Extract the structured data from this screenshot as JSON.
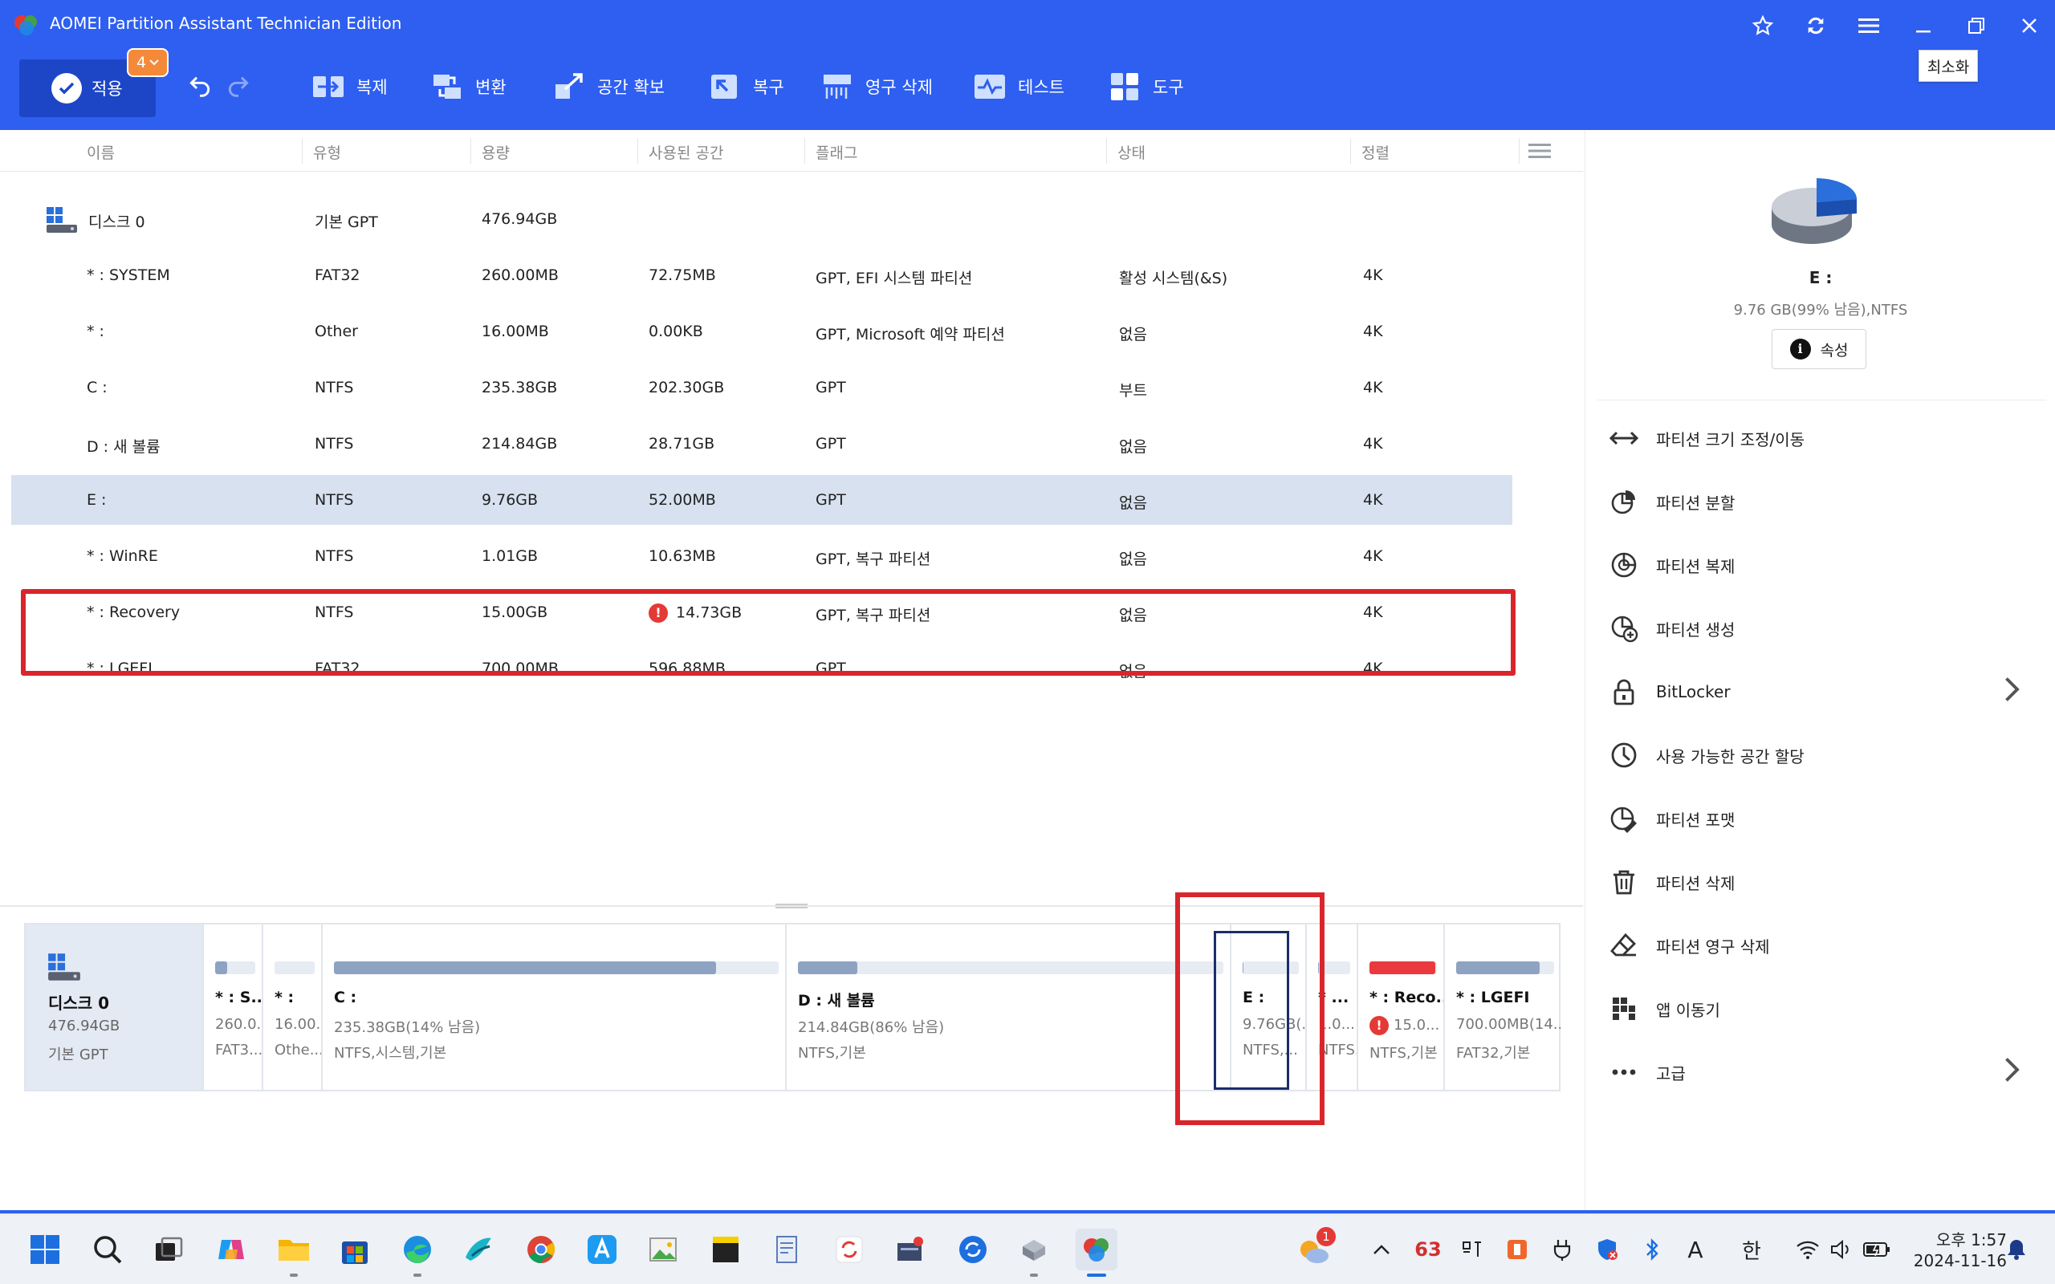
{
  "window": {
    "title": "AOMEI Partition Assistant Technician Edition",
    "tooltip": "최소화"
  },
  "toolbar": {
    "apply_label": "적용",
    "apply_badge": "4",
    "items": [
      {
        "label": "복제",
        "icon": "clone-icon"
      },
      {
        "label": "변환",
        "icon": "convert-icon"
      },
      {
        "label": "공간 확보",
        "icon": "free-up-space-icon"
      },
      {
        "label": "복구",
        "icon": "recover-icon"
      },
      {
        "label": "영구 삭제",
        "icon": "wipe-icon"
      },
      {
        "label": "테스트",
        "icon": "test-icon"
      },
      {
        "label": "도구",
        "icon": "tools-icon"
      }
    ]
  },
  "table": {
    "columns": [
      "이름",
      "유형",
      "용량",
      "사용된 공간",
      "플래그",
      "상태",
      "정렬"
    ],
    "disk_row": {
      "name": "디스크 0",
      "type": "기본 GPT",
      "capacity": "476.94GB"
    },
    "partitions": [
      {
        "name": "* : SYSTEM",
        "type": "FAT32",
        "capacity": "260.00MB",
        "used": "72.75MB",
        "flag": "GPT, EFI 시스템 파티션",
        "status": "활성 시스템(&S)",
        "align": "4K",
        "warn": false
      },
      {
        "name": "* :",
        "type": "Other",
        "capacity": "16.00MB",
        "used": "0.00KB",
        "flag": "GPT, Microsoft 예약 파티션",
        "status": "없음",
        "align": "4K",
        "warn": false
      },
      {
        "name": "C :",
        "type": "NTFS",
        "capacity": "235.38GB",
        "used": "202.30GB",
        "flag": "GPT",
        "status": "부트",
        "align": "4K",
        "warn": false
      },
      {
        "name": "D : 새 볼륨",
        "type": "NTFS",
        "capacity": "214.84GB",
        "used": "28.71GB",
        "flag": "GPT",
        "status": "없음",
        "align": "4K",
        "warn": false
      },
      {
        "name": "E :",
        "type": "NTFS",
        "capacity": "9.76GB",
        "used": "52.00MB",
        "flag": "GPT",
        "status": "없음",
        "align": "4K",
        "warn": false,
        "selected": true
      },
      {
        "name": "* : WinRE",
        "type": "NTFS",
        "capacity": "1.01GB",
        "used": "10.63MB",
        "flag": "GPT, 복구 파티션",
        "status": "없음",
        "align": "4K",
        "warn": false
      },
      {
        "name": "* : Recovery",
        "type": "NTFS",
        "capacity": "15.00GB",
        "used": "14.73GB",
        "flag": "GPT, 복구 파티션",
        "status": "없음",
        "align": "4K",
        "warn": true
      },
      {
        "name": "* : LGEFI",
        "type": "FAT32",
        "capacity": "700.00MB",
        "used": "596.88MB",
        "flag": "GPT",
        "status": "없음",
        "align": "4K",
        "warn": false
      }
    ],
    "warn_glyph": "!"
  },
  "diskmap": {
    "disk": {
      "name": "디스크 0",
      "size": "476.94GB",
      "type": "기본 GPT"
    },
    "partitions": [
      {
        "name": "* : S...",
        "size": "260.0...",
        "fs": "FAT3...",
        "used_fraction": 0.3,
        "color": "#8ea3c2"
      },
      {
        "name": "* :",
        "size": "16.00...",
        "fs": "Othe...",
        "used_fraction": 0.0,
        "color": "#8ea3c2"
      },
      {
        "name": "C :",
        "size": "235.38GB(14% 남음)",
        "fs": "NTFS,시스템,기본",
        "used_fraction": 0.86,
        "color": "#8ea3c2"
      },
      {
        "name": "D : 새 볼륨",
        "size": "214.84GB(86% 남음)",
        "fs": "NTFS,기본",
        "used_fraction": 0.14,
        "color": "#8ea3c2"
      },
      {
        "name": "E :",
        "size": "9.76GB(...",
        "fs": "NTFS,...",
        "used_fraction": 0.01,
        "color": "#8ea3c2",
        "selected": true
      },
      {
        "name": "* ...",
        "size": "1.0...",
        "fs": "NTFS...",
        "used_fraction": 0.01,
        "color": "#8ea3c2"
      },
      {
        "name": "* : Reco...",
        "size": "15.0...",
        "fs": "NTFS,기본",
        "used_fraction": 0.98,
        "color": "#ea3a3f",
        "warn": true
      },
      {
        "name": "* : LGEFI",
        "size": "700.00MB(14...",
        "fs": "FAT32,기본",
        "used_fraction": 0.85,
        "color": "#8ea3c2"
      }
    ]
  },
  "panel": {
    "name": "E :",
    "info": "9.76 GB(99% 남음),NTFS",
    "properties_label": "속성",
    "operations": [
      {
        "label": "파티션 크기 조정/이동",
        "icon": "resize-move-icon",
        "chevron": false
      },
      {
        "label": "파티션 분할",
        "icon": "split-partition-icon",
        "chevron": false
      },
      {
        "label": "파티션 복제",
        "icon": "clone-partition-icon",
        "chevron": false
      },
      {
        "label": "파티션 생성",
        "icon": "create-partition-icon",
        "chevron": false
      },
      {
        "label": "BitLocker",
        "icon": "lock-icon",
        "chevron": true
      },
      {
        "label": "사용 가능한 공간 할당",
        "icon": "allocate-space-icon",
        "chevron": false
      },
      {
        "label": "파티션 포맷",
        "icon": "format-partition-icon",
        "chevron": false
      },
      {
        "label": "파티션 삭제",
        "icon": "trash-icon",
        "chevron": false
      },
      {
        "label": "파티션 영구 삭제",
        "icon": "eraser-icon",
        "chevron": false
      },
      {
        "label": "앱 이동기",
        "icon": "app-mover-icon",
        "chevron": false
      },
      {
        "label": "고급",
        "icon": "more-dots-icon",
        "chevron": true
      }
    ]
  },
  "taskbar": {
    "notification_count": "1",
    "tray_number": "63",
    "ime_label": "한",
    "font_label": "A",
    "time": "오후 1:57",
    "date": "2024-11-16"
  },
  "colors": {
    "accent": "#2f5ff0",
    "apply_button": "#1d46c7",
    "badge": "#f5893a",
    "selection": "#d7e1ef",
    "highlight_box": "#d9262c",
    "used_bar": "#8ea3c2",
    "warn": "#ea3a3f"
  }
}
